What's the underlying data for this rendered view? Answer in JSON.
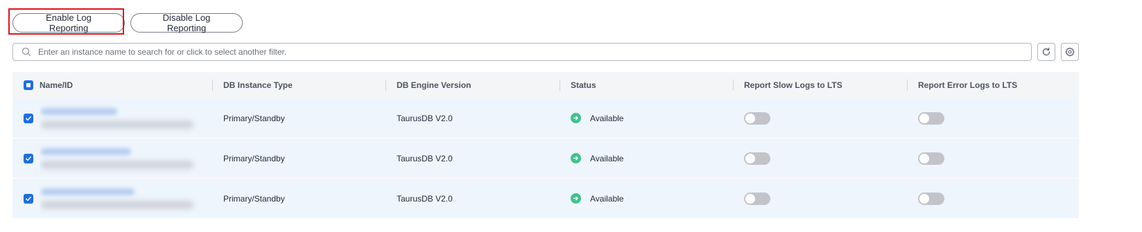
{
  "toolbar": {
    "enable_label": "Enable Log Reporting",
    "disable_label": "Disable Log Reporting"
  },
  "search": {
    "placeholder": "Enter an instance name to search for or click to select another filter."
  },
  "icons": {
    "search": "search-icon",
    "refresh": "refresh-icon",
    "settings": "gear-icon",
    "status": "arrow-right-circle-icon",
    "checkbox": "checkbox-checked-icon"
  },
  "colors": {
    "highlight": "#e0141e",
    "checkbox": "#1e6fe0",
    "status_available": "#3fc28b",
    "toggle_off": "#c2c4c9",
    "row_selected_bg": "#eff5fd"
  },
  "table": {
    "columns": [
      "Name/ID",
      "DB Instance Type",
      "DB Engine Version",
      "Status",
      "Report Slow Logs to LTS",
      "Report Error Logs to LTS"
    ],
    "header_checkbox": "partial",
    "rows": [
      {
        "checked": true,
        "type": "Primary/Standby",
        "version": "TaurusDB V2.0",
        "status": "Available",
        "slow_logs": false,
        "error_logs": false
      },
      {
        "checked": true,
        "type": "Primary/Standby",
        "version": "TaurusDB V2.0",
        "status": "Available",
        "slow_logs": false,
        "error_logs": false
      },
      {
        "checked": true,
        "type": "Primary/Standby",
        "version": "TaurusDB V2.0",
        "status": "Available",
        "slow_logs": false,
        "error_logs": false
      }
    ]
  }
}
